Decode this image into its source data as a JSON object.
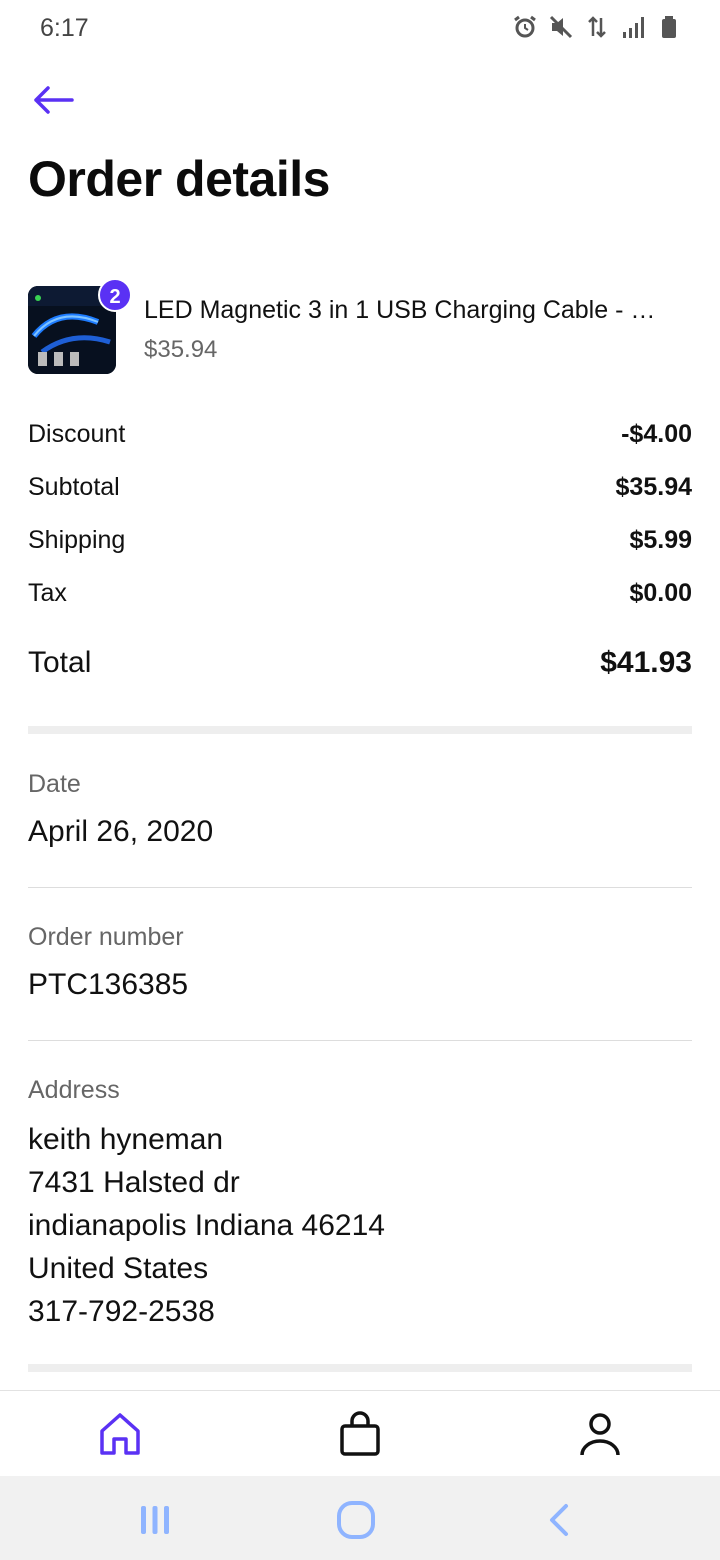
{
  "status_bar": {
    "time": "6:17",
    "icons": [
      "alarm-icon",
      "mute-icon",
      "data-arrows-icon",
      "signal-icon",
      "battery-icon"
    ]
  },
  "header": {
    "back_icon": "arrow-left-icon",
    "title": "Order details"
  },
  "accent_color": "#5a31f4",
  "product": {
    "name": "LED Magnetic 3 in 1 USB Charging Cable - …",
    "price": "$35.94",
    "quantity": "2"
  },
  "summary": {
    "discount_label": "Discount",
    "discount_value": "-$4.00",
    "subtotal_label": "Subtotal",
    "subtotal_value": "$35.94",
    "shipping_label": "Shipping",
    "shipping_value": "$5.99",
    "tax_label": "Tax",
    "tax_value": "$0.00",
    "total_label": "Total",
    "total_value": "$41.93"
  },
  "details": {
    "date_label": "Date",
    "date_value": "April 26, 2020",
    "order_label": "Order number",
    "order_value": "PTC136385",
    "address_label": "Address",
    "address_lines": [
      "keith hyneman",
      "7431 Halsted dr",
      "indianapolis Indiana 46214",
      "United States",
      "317-792-2538"
    ]
  },
  "bottom_nav": [
    "home-icon",
    "shopping-bag-icon",
    "profile-icon"
  ],
  "system_nav": [
    "recent-apps-icon",
    "home-circle-icon",
    "system-back-icon"
  ]
}
